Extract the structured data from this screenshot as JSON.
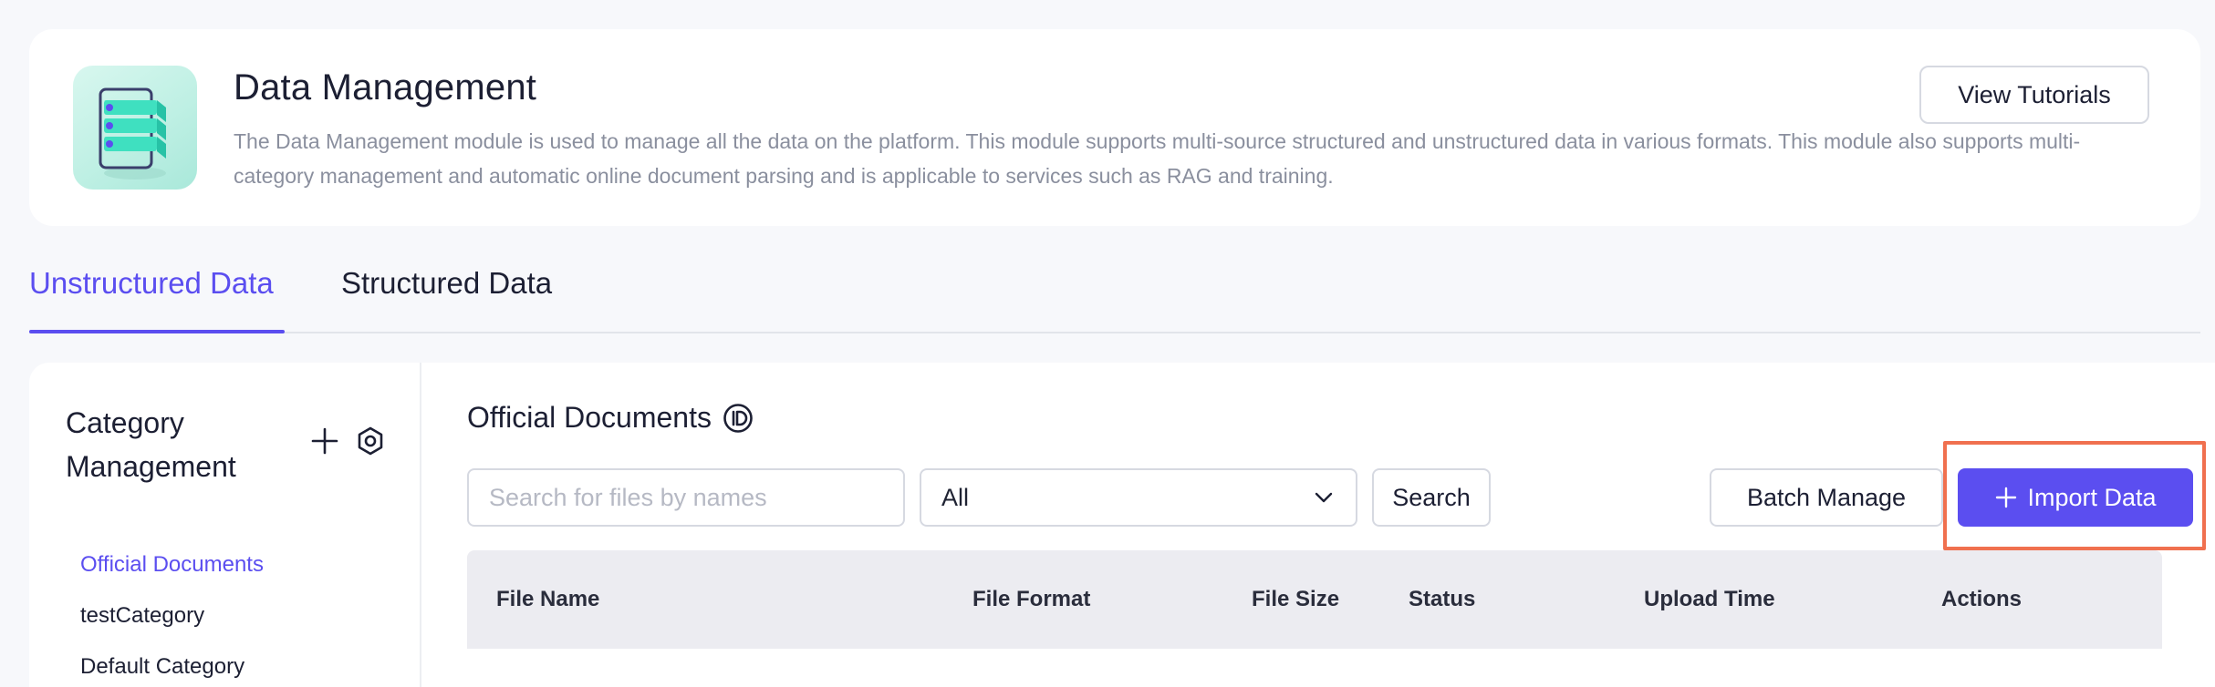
{
  "header": {
    "title": "Data Management",
    "description": "The Data Management module is used to manage all the data on the platform. This module supports multi-source structured and unstructured data in various formats. This module also supports multi-category management and automatic online document parsing and is applicable to services such as RAG and training.",
    "tutorials_label": "View Tutorials",
    "logo_icon": "layered-data-logo"
  },
  "tabs": [
    {
      "label": "Unstructured Data",
      "active": true
    },
    {
      "label": "Structured Data",
      "active": false
    }
  ],
  "sidebar": {
    "title": "Category Management",
    "add_icon": "plus-icon",
    "settings_icon": "settings-icon",
    "items": [
      {
        "label": "Official Documents",
        "active": true
      },
      {
        "label": "testCategory",
        "active": false
      },
      {
        "label": "Default Category",
        "active": false
      }
    ]
  },
  "content": {
    "title": "Official Documents",
    "title_icon": "id-icon",
    "search_placeholder": "Search for files by names",
    "search_value": "",
    "filter_value": "All",
    "search_label": "Search",
    "batch_label": "Batch Manage",
    "import_label": "Import Data",
    "table_columns": [
      "File Name",
      "File Format",
      "File Size",
      "Status",
      "Upload Time",
      "Actions"
    ]
  },
  "colors": {
    "accent": "#5b4ef0",
    "highlight": "#f0704f",
    "background": "#f7f8fb"
  }
}
